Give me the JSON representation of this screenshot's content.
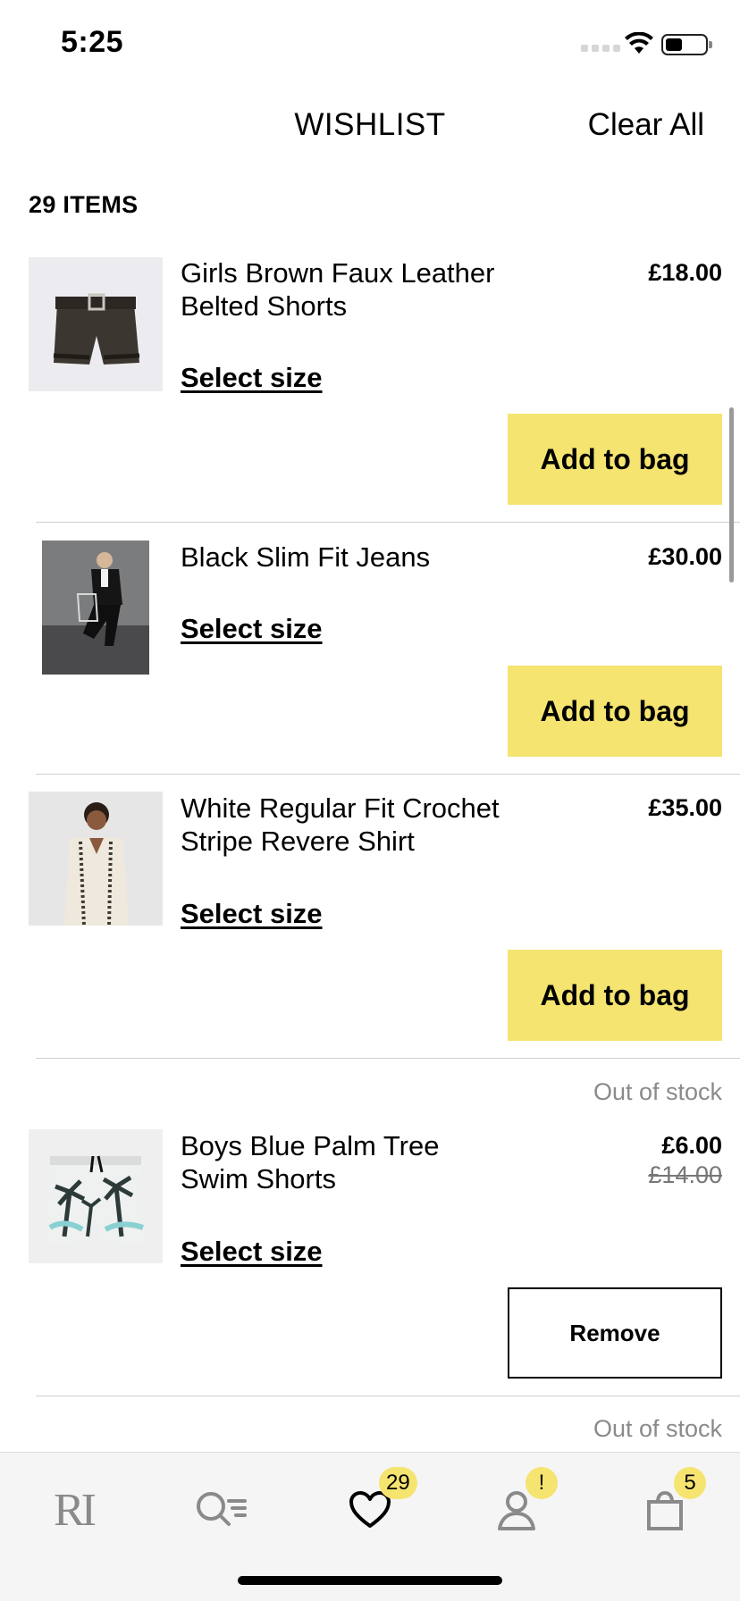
{
  "status_bar": {
    "time": "5:25"
  },
  "header": {
    "title": "WISHLIST",
    "clear_all_label": "Clear All"
  },
  "items_count": "29 ITEMS",
  "products": [
    {
      "name": "Girls Brown Faux Leather Belted Shorts",
      "price": "£18.00",
      "select_size_label": "Select size",
      "action_label": "Add to bag"
    },
    {
      "name": "Black Slim Fit Jeans",
      "price": "£30.00",
      "select_size_label": "Select size",
      "action_label": "Add to bag"
    },
    {
      "name": "White Regular Fit Crochet Stripe Revere Shirt",
      "price": "£35.00",
      "select_size_label": "Select size",
      "action_label": "Add to bag"
    },
    {
      "stock_status": "Out of stock",
      "name": "Boys Blue Palm Tree Swim Shorts",
      "price": "£6.00",
      "old_price": "£14.00",
      "select_size_label": "Select size",
      "action_label": "Remove"
    }
  ],
  "next_item_status": "Out of stock",
  "tabbar": {
    "home_logo": "RI",
    "wishlist_badge": "29",
    "account_badge": "!",
    "bag_badge": "5"
  },
  "colors": {
    "accent": "#f5e470",
    "muted_text": "#8a8a8a"
  }
}
